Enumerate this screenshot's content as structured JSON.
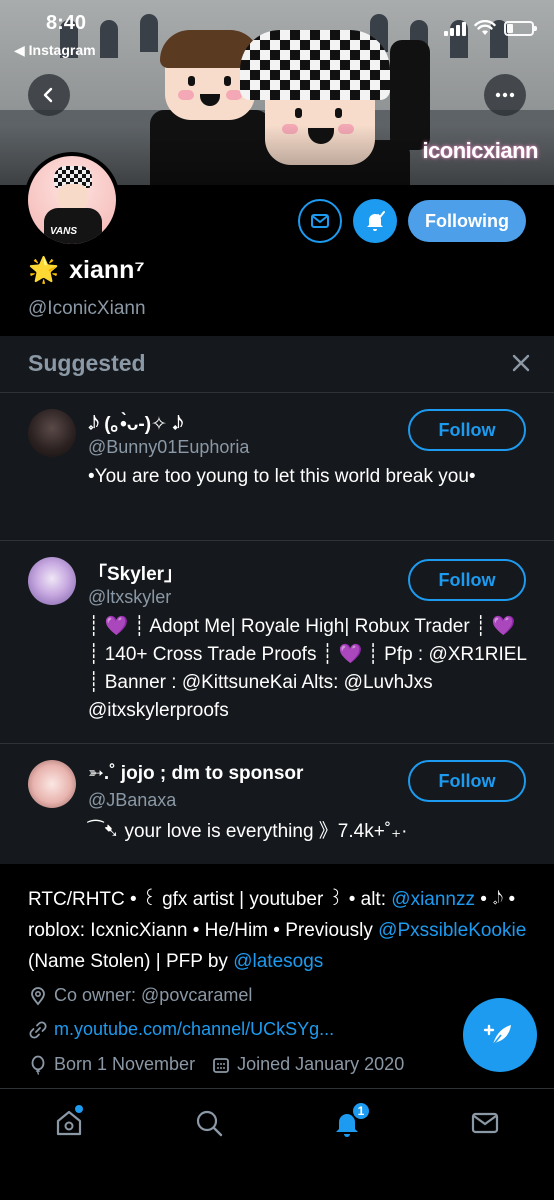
{
  "status_bar": {
    "time": "8:40",
    "back_app": "◀ Instagram"
  },
  "banner": {
    "watermark": "iconicxiann"
  },
  "profile": {
    "display_name": "xiann⁷",
    "name_emoji": "🌟",
    "handle": "@IconicXiann",
    "following_label": "Following",
    "pfp_text": "VANS"
  },
  "suggested": {
    "title": "Suggested",
    "follow_label": "Follow",
    "items": [
      {
        "name": "𝆹𝅥𝅮 (｡•̀ᴗ-)✧ 𝆺𝅥𝅮",
        "handle": "@Bunny01Euphoria",
        "bio": "•You are too young to let this world break you•"
      },
      {
        "name": "「Skyler」",
        "handle": "@ltxskyler",
        "bio": "┊ 💜 ┊ Adopt Me| Royale High| Robux Trader ┊ 💜 ┊ 140+ Cross Trade Proofs ┊ 💜 ┊ Pfp : @XR1RIEL ┊ Banner : @KittsuneKai Alts: @LuvhJxs @itxskylerproofs"
      },
      {
        "name": "➳.˚ jojo ; dm to sponsor",
        "handle": "@JBanaxa",
        "bio": "⁀➷ your love is everything 》7.4k+˚₊·"
      }
    ]
  },
  "bio": {
    "part1": "RTC/RHTC • ꒰ gfx artist | youtuber ꒱ • alt: ",
    "alt_link": "@xiannzz",
    "part2": " • 𝆹𝅥𝅮 • roblox: IcxnicXiann • He/Him • Previously ",
    "prev_link": "@PxssibleKookie",
    "part3": " (Name Stolen) | PFP by ",
    "pfp_link": "@latesogs",
    "location": "Co owner: @povcaramel",
    "website": "m.youtube.com/channel/UCkSYg...",
    "born": "Born 1 November",
    "joined": "Joined January 2020"
  },
  "nav": {
    "notifications_badge": "1"
  },
  "colors": {
    "accent": "#1d9bf0",
    "panel": "#15181c",
    "muted": "#8b98a5"
  }
}
